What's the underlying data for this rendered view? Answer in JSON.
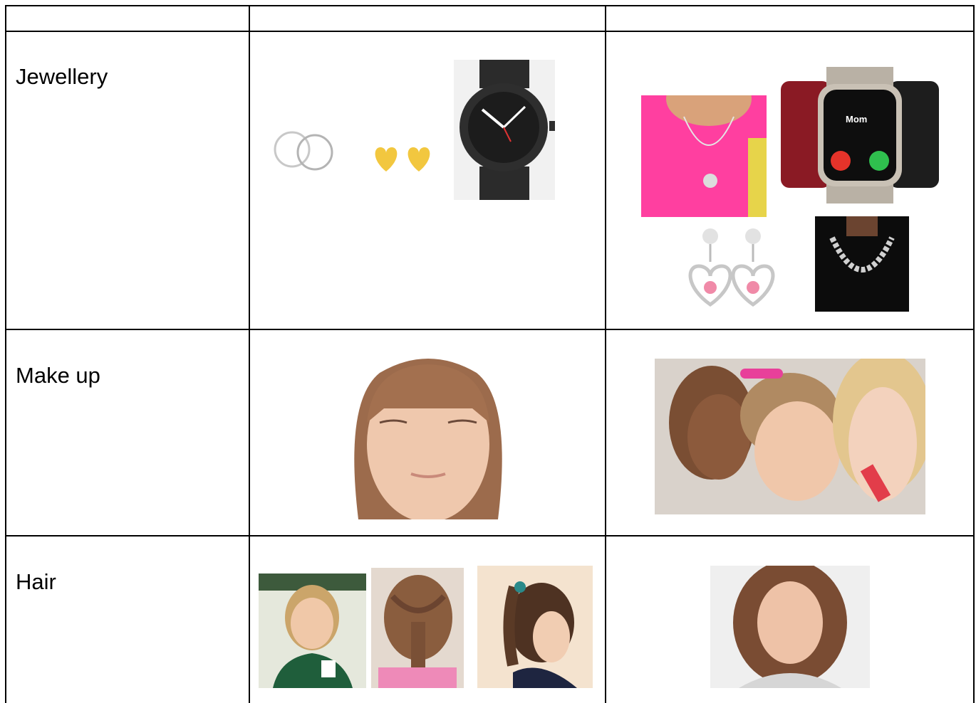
{
  "table": {
    "header": [
      "",
      "",
      ""
    ],
    "rows": [
      {
        "label": "Jewellery",
        "col2_images": [
          "silver-hoop-earrings",
          "gold-heart-stud-earrings",
          "black-analog-watch"
        ],
        "col3_images": [
          "girl-with-pendant-necklace",
          "smart-watches"
        ],
        "col3_lower_images": [
          "pink-heart-drop-earrings",
          "silver-chain-necklace"
        ]
      },
      {
        "label": "Make up",
        "col2_images": [
          "girl-no-makeup"
        ],
        "col3_images": [
          "girls-applying-makeup"
        ]
      },
      {
        "label": "Hair",
        "col2_images": [
          "girl-long-hair-uniform",
          "braided-half-up-ponytail",
          "high-ponytail"
        ],
        "col3_images": [
          "girl-loose-messy-hair"
        ]
      }
    ]
  },
  "watch_screen": {
    "caller": "Mom"
  },
  "colors": {
    "grid": "#000000",
    "watch_face": "#1c1c1c",
    "gold_heart": "#f2c73f",
    "accept_green": "#2fbf4e",
    "decline_red": "#e5332a",
    "shirt_pink": "#ff3fa0"
  }
}
